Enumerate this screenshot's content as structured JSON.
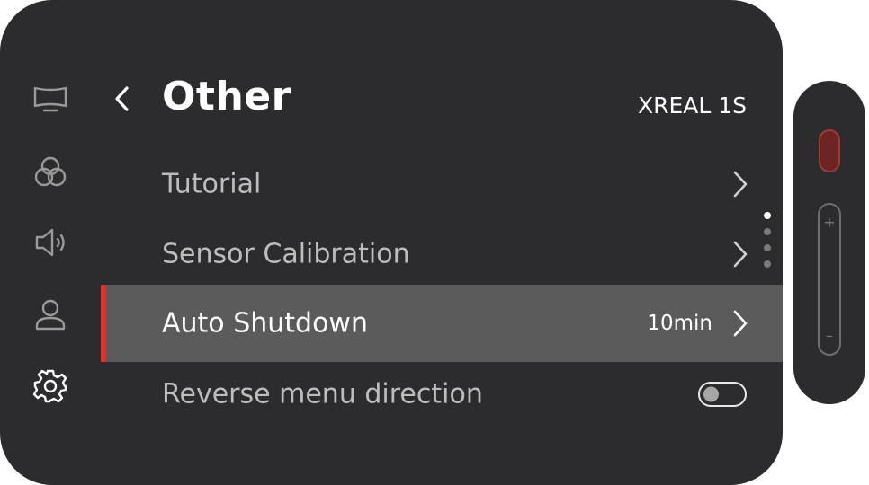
{
  "header": {
    "title": "Other",
    "device_name": "XREAL 1S"
  },
  "sidebar": {
    "items": [
      {
        "icon": "display-icon",
        "active": false
      },
      {
        "icon": "color-circles-icon",
        "active": false
      },
      {
        "icon": "speaker-icon",
        "active": false
      },
      {
        "icon": "user-icon",
        "active": false
      },
      {
        "icon": "gear-icon",
        "active": true
      }
    ]
  },
  "menu": {
    "items": [
      {
        "label": "Tutorial",
        "control": "chevron"
      },
      {
        "label": "Sensor Calibration",
        "control": "chevron"
      },
      {
        "label": "Auto Shutdown",
        "value": "10min",
        "control": "chevron",
        "selected": true
      },
      {
        "label": "Reverse menu direction",
        "control": "toggle",
        "toggle_on": false
      }
    ]
  },
  "pagination": {
    "total": 4,
    "active_index": 0
  },
  "remote": {
    "plus_label": "+",
    "minus_label": "–"
  },
  "colors": {
    "panel_bg": "#2c2c2e",
    "selected_row_bg": "#5b5b5c",
    "accent_red": "#e8302a",
    "text_primary": "#ffffff",
    "text_secondary": "#bdbdbd",
    "icon_gray": "#9a9a9a"
  }
}
